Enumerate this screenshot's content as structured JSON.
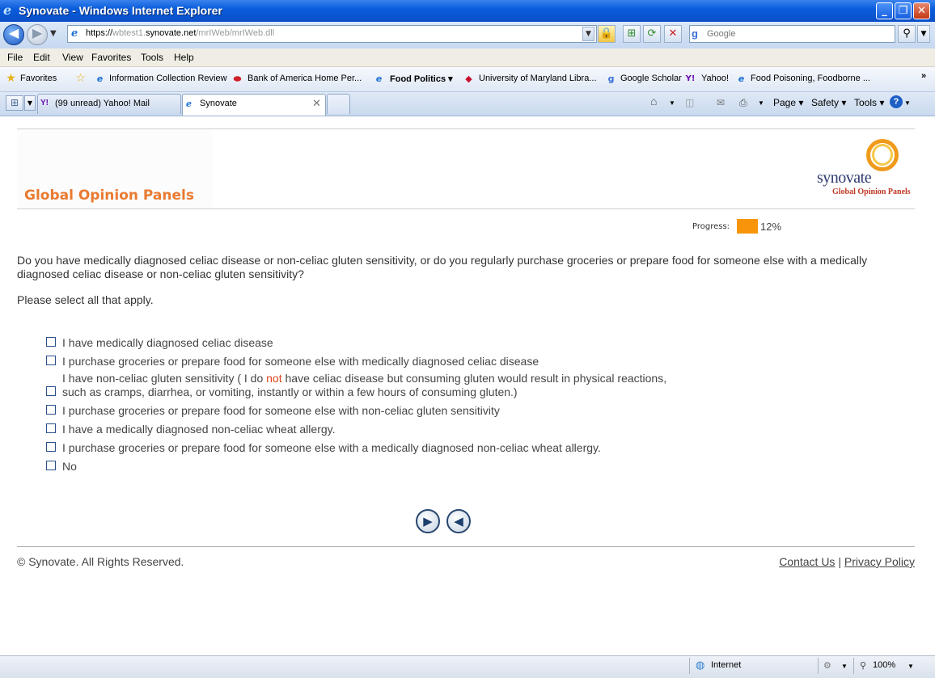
{
  "window": {
    "title": "Synovate - Windows Internet Explorer"
  },
  "address_bar": {
    "url_prefix": "https://",
    "url_host_start": "wbtest1.",
    "url_host": "synovate.net",
    "url_path": "/mrIWeb/mrIWeb.dll"
  },
  "search": {
    "placeholder": "Google"
  },
  "menu": [
    "File",
    "Edit",
    "View",
    "Favorites",
    "Tools",
    "Help"
  ],
  "favorites_bar": {
    "label": "Favorites",
    "items": [
      "Information Collection Review",
      "Bank of America  Home  Per...",
      "Food Politics",
      "University of Maryland Libra...",
      "Google Scholar",
      "Yahoo!",
      "Food Poisoning, Foodborne ..."
    ]
  },
  "tabs": [
    {
      "label": "(99 unread) Yahoo! Mail"
    },
    {
      "label": "Synovate"
    }
  ],
  "command_bar": {
    "page": "Page",
    "safety": "Safety",
    "tools": "Tools"
  },
  "site": {
    "title": "Global Opinion Panels",
    "brand_name": "synovate",
    "brand_tagline": "Global Opinion Panels"
  },
  "progress": {
    "label": "Progress:",
    "percent_text": "12%",
    "value": 0.12
  },
  "survey": {
    "question": "Do you have medically diagnosed celiac disease or non-celiac gluten sensitivity, or do you regularly purchase groceries or prepare food for someone else with a medically diagnosed celiac disease or non-celiac gluten sensitivity?",
    "instruction": "Please select all that apply.",
    "options": [
      "I have medically diagnosed celiac disease",
      "I purchase groceries or prepare food for someone else with medically diagnosed celiac disease",
      "I have non-celiac gluten sensitivity ( I do not have celiac disease but consuming gluten would result in physical reactions, such as cramps, diarrhea, or vomiting, instantly or within a few hours of consuming gluten.)",
      "I purchase groceries or prepare food for someone else with non-celiac gluten sensitivity",
      "I have a medically diagnosed non-celiac wheat allergy.",
      "I purchase groceries or prepare food for someone else with a medically diagnosed non-celiac wheat allergy.",
      "No"
    ],
    "option3_parts": {
      "line1_before": "I have non-celiac gluten sensitivity ( I do ",
      "emphasis": "not",
      "line1_after": " have celiac disease but consuming gluten would result in physical reactions,",
      "line2": "such as cramps, diarrhea, or vomiting, instantly or within a few hours of consuming gluten.)"
    }
  },
  "footer": {
    "copyright": "© Synovate. All Rights Reserved.",
    "contact": "Contact Us",
    "separator": "|",
    "privacy": "Privacy Policy"
  },
  "status_bar": {
    "zone": "Internet",
    "zoom": "100%"
  },
  "colors": {
    "accent_orange": "#e97a31",
    "progress_fill": "#f7940a",
    "brand_red": "#c03a27",
    "ie_blue": "#0a5ddc"
  }
}
